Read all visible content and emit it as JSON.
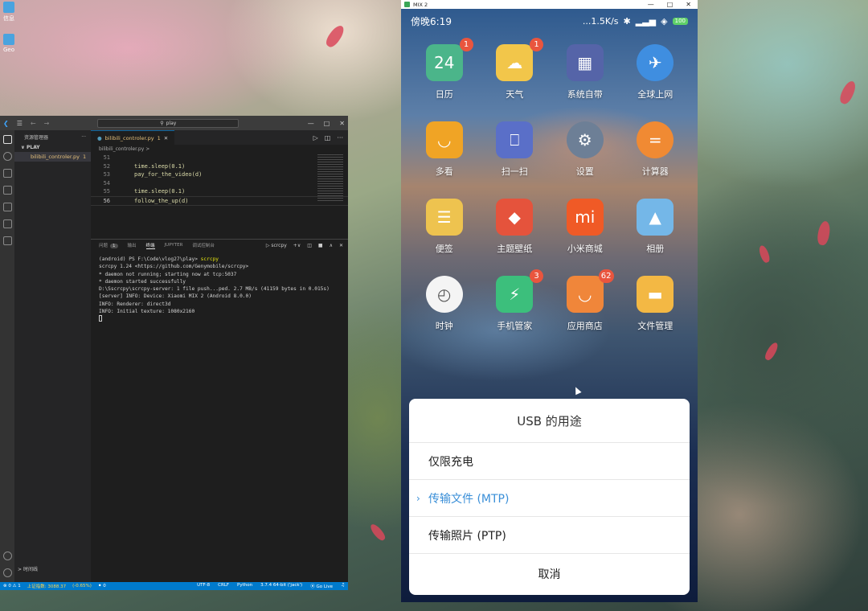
{
  "desktop": {
    "icons": [
      {
        "label": "信息"
      },
      {
        "label": "Geo"
      }
    ]
  },
  "vscode": {
    "search_text": "play",
    "sidebar": {
      "header": "资源管理器",
      "section": "PLAY",
      "file": "bilibili_controler.py",
      "file_badge": "1",
      "footer": "时间线"
    },
    "tab": {
      "label": "bilibili_controler.py",
      "badge": "1"
    },
    "breadcrumb": "bilibili_controler.py >",
    "code": [
      {
        "ln": "51",
        "text": ""
      },
      {
        "ln": "52",
        "text": "time.sleep(0.1)"
      },
      {
        "ln": "53",
        "text": "pay_for_the_video(d)"
      },
      {
        "ln": "54",
        "text": ""
      },
      {
        "ln": "55",
        "text": "time.sleep(0.1)"
      },
      {
        "ln": "56",
        "text": "follow_the_up(d)"
      }
    ],
    "panel": {
      "tabs": [
        "问题",
        "输出",
        "终端",
        "JUPYTER",
        "调试控制台"
      ],
      "problems_count": "1",
      "terminal_name": "scrcpy"
    },
    "terminal": {
      "prompt": "(android) PS F:\\Code\\vlog27\\play>",
      "command": "scrcpy",
      "lines": [
        "scrcpy 1.24 <https://github.com/Genymobile/scrcpy>",
        "* daemon not running; starting now at tcp:5037",
        "* daemon started successfully",
        "D:\\Sscrcpy\\scrcpy-server: 1 file push...ped. 2.7 MB/s (41159 bytes in 0.015s)",
        "[server] INFO: Device: Xiaomi MIX 2 (Android 8.0.0)",
        "INFO: Renderer: direct3d",
        "INFO: Initial texture: 1080x2160"
      ]
    },
    "statusbar": {
      "errors": "⊗ 0 ⚠ 1",
      "left_extra": "上证指数: 3088.37",
      "change": "(-0.65%)",
      "ports": "0",
      "encoding": "UTF-8",
      "eol": "CRLF",
      "language": "Python",
      "interpreter": "3.7.4 64-bit ('jack')",
      "golive": "Go Live"
    }
  },
  "phone": {
    "window_title": "MIX 2",
    "status": {
      "time": "傍晚6:19",
      "speed": "...1.5K/s",
      "battery": "100"
    },
    "apps": [
      {
        "label": "日历",
        "badge": "1",
        "glyph": "24",
        "color": "#4bb58a"
      },
      {
        "label": "天气",
        "badge": "1",
        "glyph": "☁",
        "color": "#f2c64a"
      },
      {
        "label": "系统自带",
        "badge": "",
        "glyph": "▦",
        "color": "#5564a8"
      },
      {
        "label": "全球上网",
        "badge": "",
        "glyph": "✈",
        "color": "#3f8ee0"
      },
      {
        "label": "多看",
        "badge": "",
        "glyph": "◡",
        "color": "#f0a425"
      },
      {
        "label": "扫一扫",
        "badge": "",
        "glyph": "⎕",
        "color": "#5a6fc8"
      },
      {
        "label": "设置",
        "badge": "",
        "glyph": "⚙",
        "color": "#6d7f96"
      },
      {
        "label": "计算器",
        "badge": "",
        "glyph": "=",
        "color": "#f08a33"
      },
      {
        "label": "便签",
        "badge": "",
        "glyph": "☰",
        "color": "#eec34f"
      },
      {
        "label": "主题壁纸",
        "badge": "",
        "glyph": "◆",
        "color": "#e5533c"
      },
      {
        "label": "小米商城",
        "badge": "",
        "glyph": "mi",
        "color": "#f05a26"
      },
      {
        "label": "相册",
        "badge": "",
        "glyph": "▲",
        "color": "#74b7e8"
      },
      {
        "label": "时钟",
        "badge": "",
        "glyph": "◴",
        "color": "#f4f4f4"
      },
      {
        "label": "手机管家",
        "badge": "3",
        "glyph": "⚡",
        "color": "#3cbf7c"
      },
      {
        "label": "应用商店",
        "badge": "62",
        "glyph": "◡",
        "color": "#f0863a"
      },
      {
        "label": "文件管理",
        "badge": "",
        "glyph": "▬",
        "color": "#f3b844"
      }
    ],
    "dialog": {
      "title": "USB 的用途",
      "options": [
        {
          "label": "仅限充电",
          "selected": false
        },
        {
          "label": "传输文件 (MTP)",
          "selected": true
        },
        {
          "label": "传输照片 (PTP)",
          "selected": false
        }
      ],
      "cancel": "取消"
    }
  }
}
